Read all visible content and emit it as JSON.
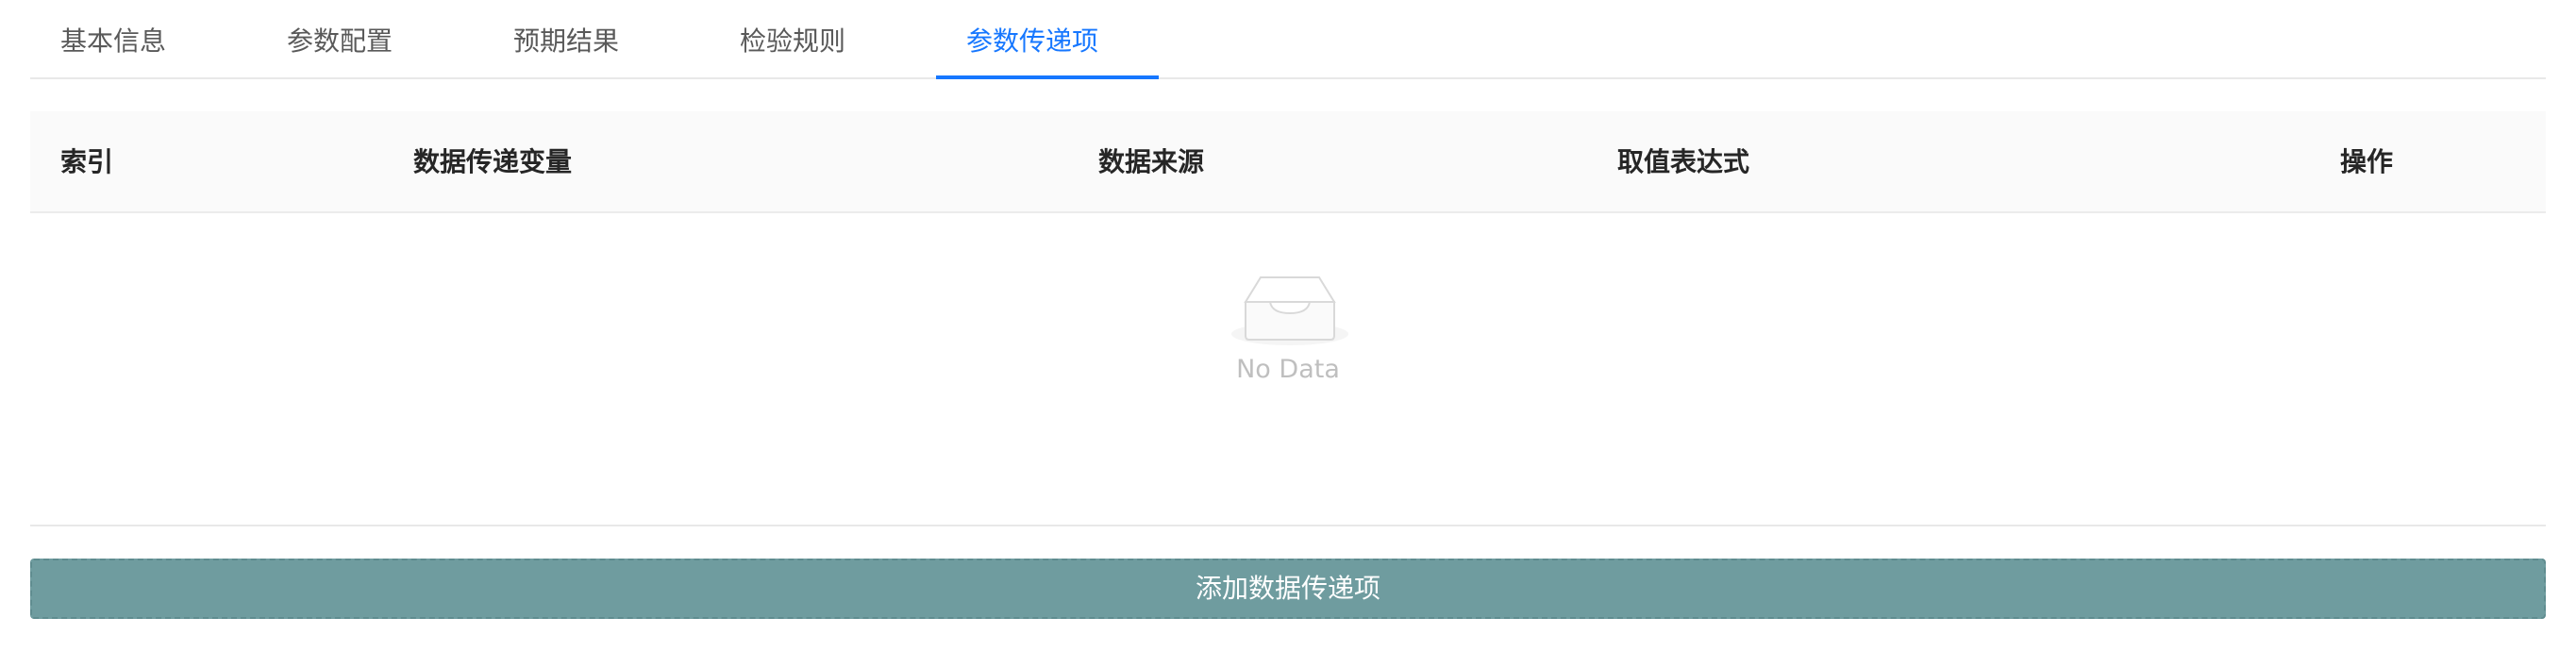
{
  "tabs": [
    {
      "label": "基本信息",
      "active": false
    },
    {
      "label": "参数配置",
      "active": false
    },
    {
      "label": "预期结果",
      "active": false
    },
    {
      "label": "检验规则",
      "active": false
    },
    {
      "label": "参数传递项",
      "active": true
    }
  ],
  "table": {
    "columns": [
      "索引",
      "数据传递变量",
      "数据来源",
      "取值表达式",
      "操作"
    ],
    "rows": [],
    "empty_text": "No Data"
  },
  "add_button_label": "添加数据传递项",
  "colors": {
    "accent": "#1677ff",
    "add_button": "#6f9c9f"
  },
  "icons": {
    "empty": "inbox-icon"
  }
}
